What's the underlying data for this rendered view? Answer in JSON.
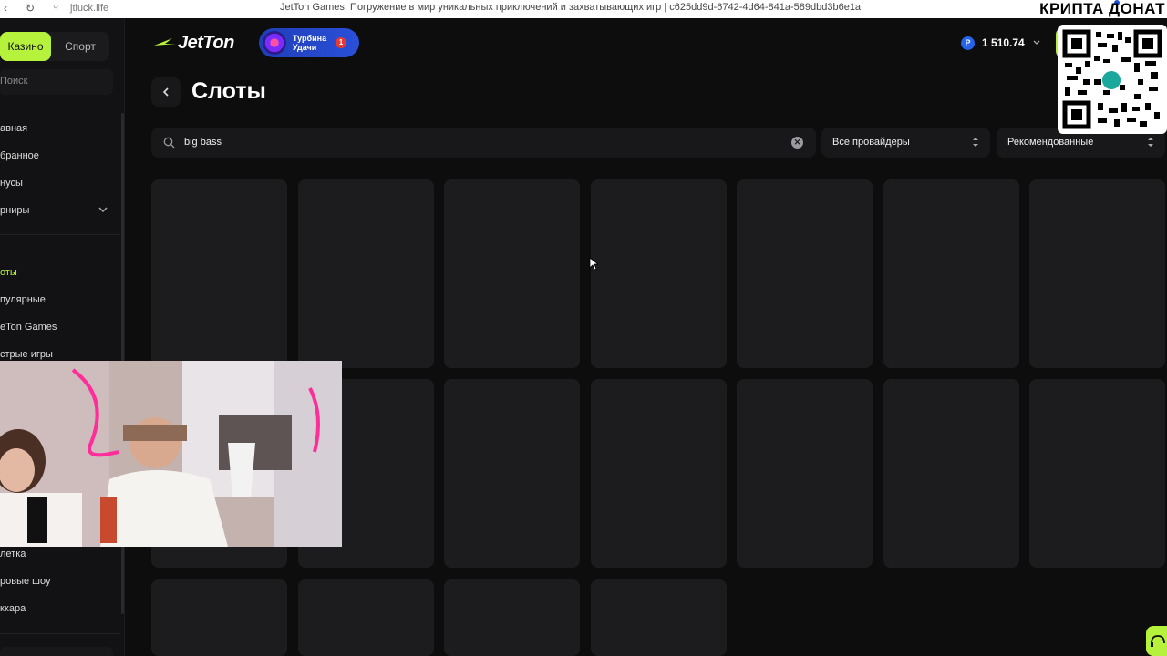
{
  "browser": {
    "url": "jtluck.life",
    "title": "JetTon Games: Погружение в мир уникальных приключений и захватывающих игр | c625dd9d-6742-4d64-841a-589dbd3b6e1a"
  },
  "overlay": {
    "caption": "КРИПТА ДОНАТ"
  },
  "sidebar": {
    "tabs": [
      {
        "label": "Казино",
        "active": true
      },
      {
        "label": "Спорт",
        "active": false
      }
    ],
    "search_placeholder": "Поиск",
    "menu_top": [
      "авная",
      "бранное",
      "нусы",
      "рниры"
    ],
    "menu_categories": [
      "оты",
      "пулярные",
      "eTon Games",
      "стрые игры"
    ],
    "menu_bottom": [
      "летка",
      "ровые шоу",
      "ккара"
    ]
  },
  "header": {
    "logo_text": "JetTon",
    "turbo": {
      "line1": "Турбина",
      "line2": "Удачи",
      "badge": "1"
    },
    "balance": {
      "currency_symbol": "P",
      "value": "1 510.74"
    }
  },
  "page": {
    "title": "Слоты"
  },
  "filters": {
    "search_value": "big bass",
    "providers": "Все провайдеры",
    "sort": "Рекомендованные"
  },
  "colors": {
    "accent": "#b6f23b",
    "background": "#0d0d0e",
    "tile": "#1c1c1e"
  }
}
